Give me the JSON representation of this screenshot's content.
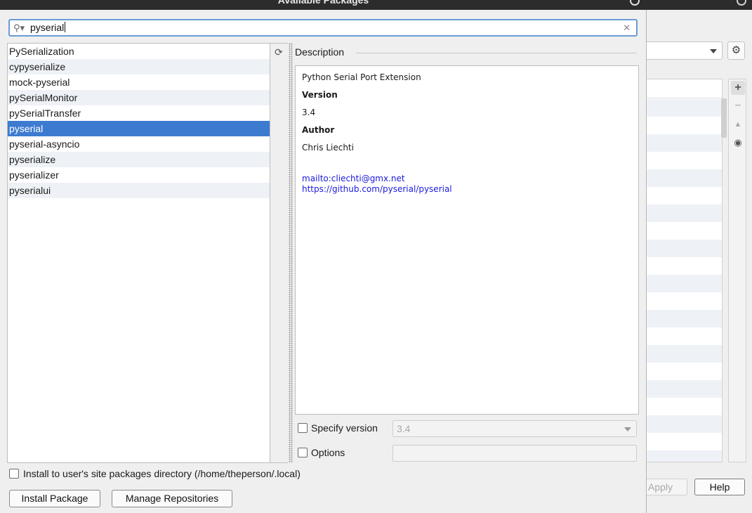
{
  "dialog": {
    "title": "Available Packages",
    "search": {
      "value": "pyserial"
    },
    "packages": [
      {
        "name": "PySerialization",
        "selected": false
      },
      {
        "name": "cypyserialize",
        "selected": false
      },
      {
        "name": "mock-pyserial",
        "selected": false
      },
      {
        "name": "pySerialMonitor",
        "selected": false
      },
      {
        "name": "pySerialTransfer",
        "selected": false
      },
      {
        "name": "pyserial",
        "selected": true
      },
      {
        "name": "pyserial-asyncio",
        "selected": false
      },
      {
        "name": "pyserialize",
        "selected": false
      },
      {
        "name": "pyserializer",
        "selected": false
      },
      {
        "name": "pyserialui",
        "selected": false
      }
    ],
    "description": {
      "header": "Description",
      "summary": "Python Serial Port Extension",
      "version_label": "Version",
      "version": "3.4",
      "author_label": "Author",
      "author": "Chris Liechti",
      "email_link": "mailto:cliechti@gmx.net",
      "home_link": "https://github.com/pyserial/pyserial"
    },
    "specify_version": {
      "label": "Specify version",
      "value": "3.4",
      "checked": false
    },
    "options": {
      "label": "Options",
      "value": "",
      "checked": false
    },
    "install_user": {
      "label": "Install to user's site packages directory (/home/theperson/.local)",
      "checked": false
    },
    "buttons": {
      "install": "Install Package",
      "manage_repos": "Manage Repositories"
    }
  },
  "background_window": {
    "apply_label": "Apply",
    "help_label": "Help"
  },
  "colors": {
    "selection": "#3d7bd1",
    "focus_border": "#6a9bd5",
    "link": "#1a1adb",
    "titlebar": "#2c2c2c"
  },
  "icons": [
    "search-icon",
    "clear-icon",
    "refresh-icon",
    "gear-icon",
    "add-icon",
    "remove-icon",
    "up-icon",
    "eye-icon",
    "user-icon"
  ]
}
